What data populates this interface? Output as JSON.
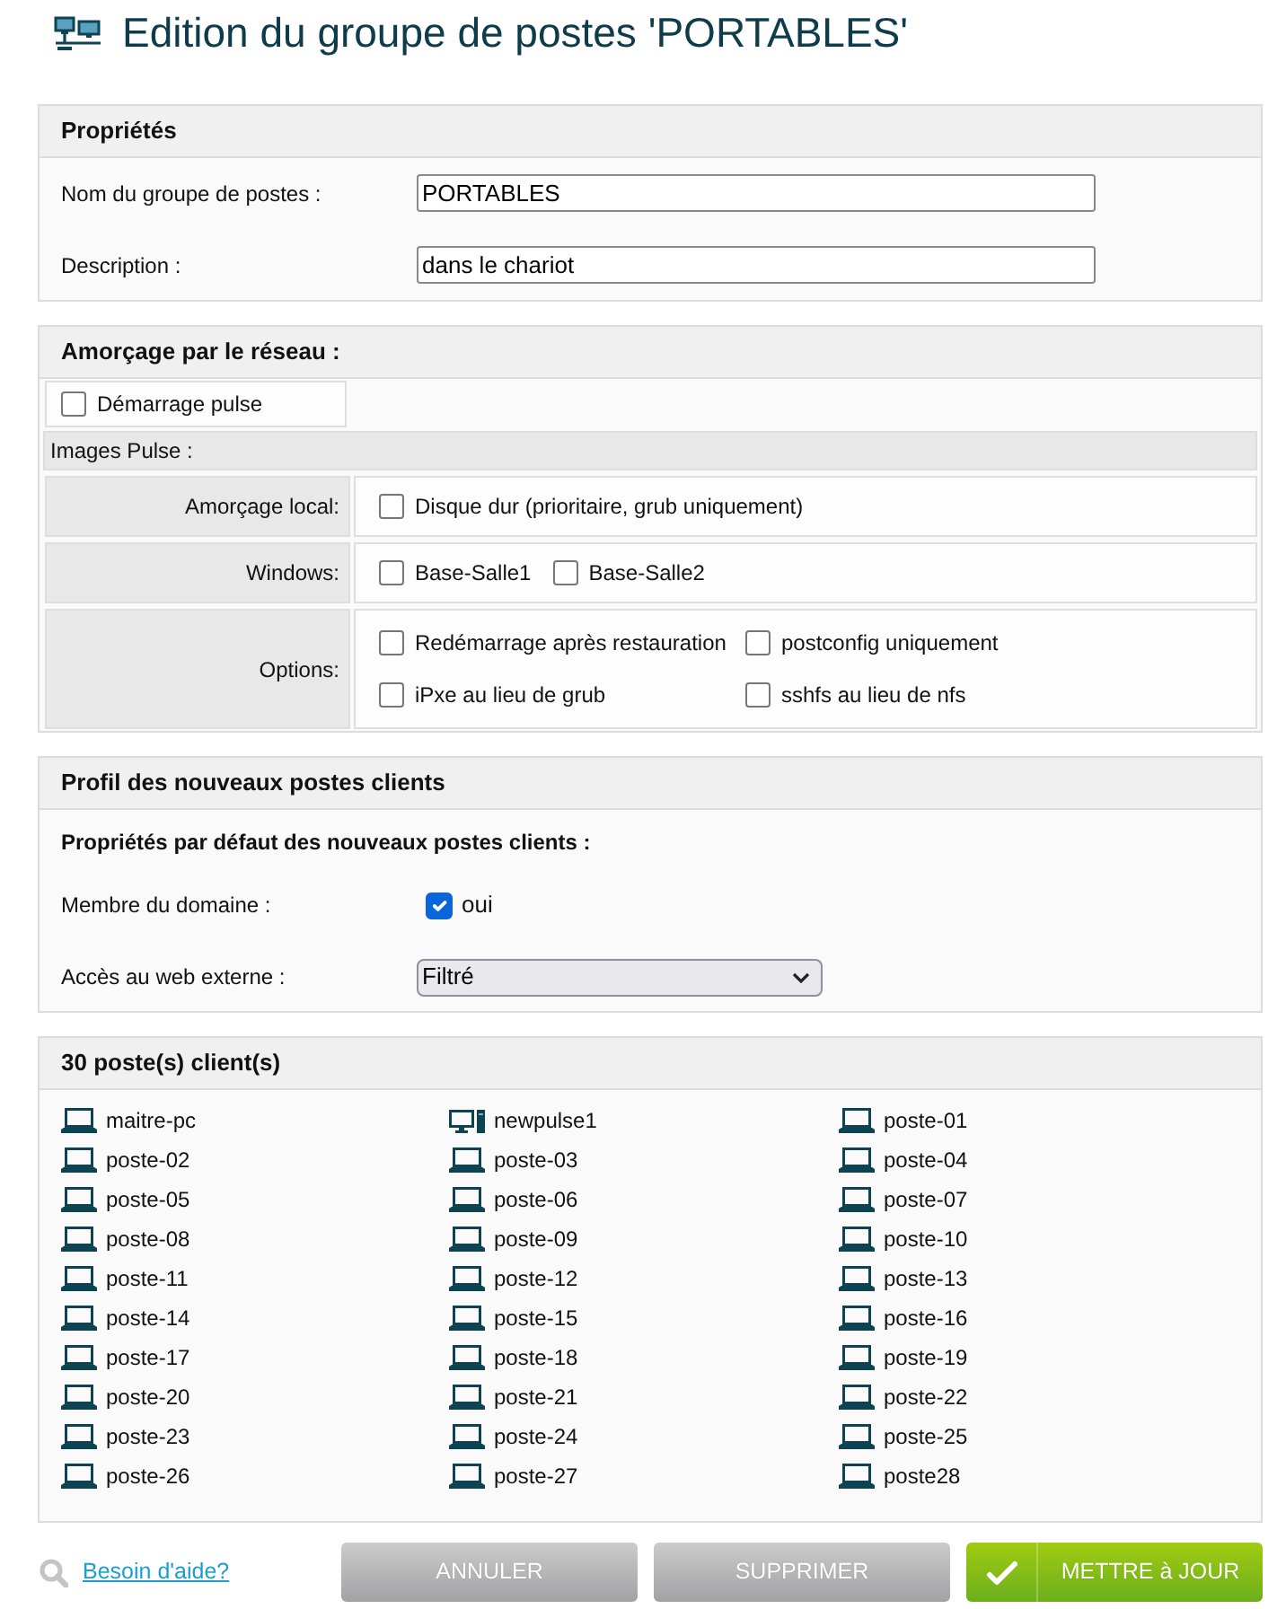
{
  "page": {
    "title": "Edition du groupe de postes 'PORTABLES'"
  },
  "properties": {
    "title": "Propriétés",
    "fields": [
      {
        "label": "Nom du groupe de postes :",
        "value": "PORTABLES"
      },
      {
        "label": "Description :",
        "value": "dans le chariot"
      }
    ]
  },
  "network_boot": {
    "title": "Amorçage par le réseau :",
    "pulse_boot": {
      "label": "Démarrage pulse",
      "checked": false
    },
    "images_title": "Images Pulse :",
    "rows": [
      {
        "label": "Amorçage local:",
        "kind": "inline",
        "options": [
          {
            "label": "Disque dur (prioritaire, grub uniquement)",
            "checked": false
          }
        ]
      },
      {
        "label": "Windows:",
        "kind": "inline",
        "options": [
          {
            "label": "Base-Salle1",
            "checked": false
          },
          {
            "label": "Base-Salle2",
            "checked": false
          }
        ]
      },
      {
        "label": "Options:",
        "kind": "grid",
        "options": [
          {
            "label": "Redémarrage après restauration",
            "checked": false
          },
          {
            "label": "postconfig uniquement",
            "checked": false
          },
          {
            "label": "iPxe au lieu de grub",
            "checked": false
          },
          {
            "label": "sshfs au lieu de nfs",
            "checked": false
          }
        ]
      }
    ]
  },
  "client_profile": {
    "title": "Profil des nouveaux postes clients",
    "subtitle": "Propriétés par défaut des nouveaux postes clients :",
    "domain": {
      "label": "Membre du domaine :",
      "option": "oui",
      "checked": true
    },
    "web_access": {
      "label": "Accès au web externe :",
      "value": "Filtré"
    }
  },
  "clients": {
    "title": "30 poste(s) client(s)",
    "items": [
      {
        "name": "maitre-pc",
        "kind": "laptop"
      },
      {
        "name": "newpulse1",
        "kind": "desktop"
      },
      {
        "name": "poste-01",
        "kind": "laptop"
      },
      {
        "name": "poste-02",
        "kind": "laptop"
      },
      {
        "name": "poste-03",
        "kind": "laptop"
      },
      {
        "name": "poste-04",
        "kind": "laptop"
      },
      {
        "name": "poste-05",
        "kind": "laptop"
      },
      {
        "name": "poste-06",
        "kind": "laptop"
      },
      {
        "name": "poste-07",
        "kind": "laptop"
      },
      {
        "name": "poste-08",
        "kind": "laptop"
      },
      {
        "name": "poste-09",
        "kind": "laptop"
      },
      {
        "name": "poste-10",
        "kind": "laptop"
      },
      {
        "name": "poste-11",
        "kind": "laptop"
      },
      {
        "name": "poste-12",
        "kind": "laptop"
      },
      {
        "name": "poste-13",
        "kind": "laptop"
      },
      {
        "name": "poste-14",
        "kind": "laptop"
      },
      {
        "name": "poste-15",
        "kind": "laptop"
      },
      {
        "name": "poste-16",
        "kind": "laptop"
      },
      {
        "name": "poste-17",
        "kind": "laptop"
      },
      {
        "name": "poste-18",
        "kind": "laptop"
      },
      {
        "name": "poste-19",
        "kind": "laptop"
      },
      {
        "name": "poste-20",
        "kind": "laptop"
      },
      {
        "name": "poste-21",
        "kind": "laptop"
      },
      {
        "name": "poste-22",
        "kind": "laptop"
      },
      {
        "name": "poste-23",
        "kind": "laptop"
      },
      {
        "name": "poste-24",
        "kind": "laptop"
      },
      {
        "name": "poste-25",
        "kind": "laptop"
      },
      {
        "name": "poste-26",
        "kind": "laptop"
      },
      {
        "name": "poste-27",
        "kind": "laptop"
      },
      {
        "name": "poste28",
        "kind": "laptop"
      }
    ]
  },
  "footer": {
    "help_link": "Besoin d'aide?",
    "buttons": [
      {
        "label": "ANNULER",
        "kind": "neutral"
      },
      {
        "label": "SUPPRIMER",
        "kind": "neutral"
      },
      {
        "label": "METTRE à JOUR",
        "kind": "confirm"
      }
    ]
  }
}
